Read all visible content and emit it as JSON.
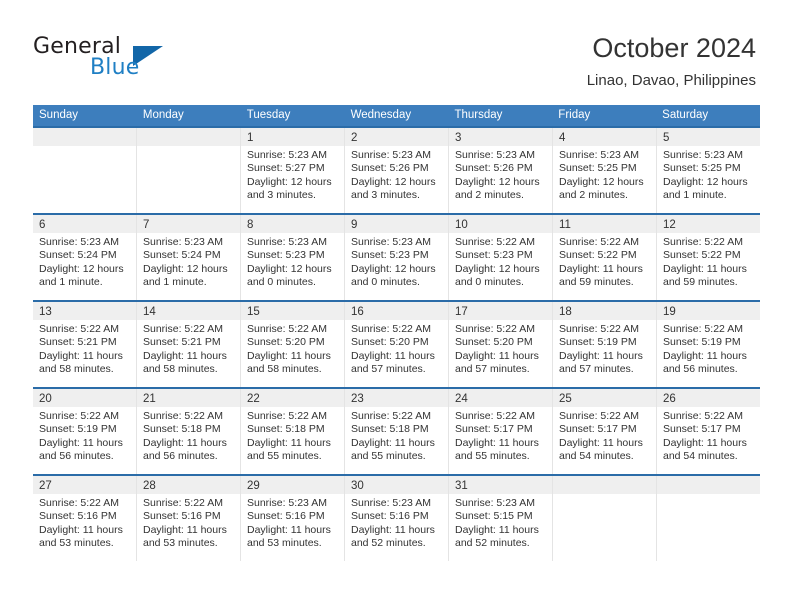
{
  "brand": {
    "name_part1": "General",
    "name_part2": "Blue",
    "triangle_icon": "triangle-icon",
    "accent_color": "#1f7fc4",
    "triangle_color": "#1266a8"
  },
  "header": {
    "title": "October 2024",
    "subtitle": "Linao, Davao, Philippines"
  },
  "colors": {
    "header_row_bg": "#3d7ebd",
    "week_divider": "#2b6ca8",
    "day_head_bg": "#efefef",
    "text": "#333333"
  },
  "weekdays": [
    "Sunday",
    "Monday",
    "Tuesday",
    "Wednesday",
    "Thursday",
    "Friday",
    "Saturday"
  ],
  "weeks": [
    [
      {
        "day": "",
        "sunrise": "",
        "sunset": "",
        "daylight_line1": "",
        "daylight_line2": "",
        "empty": true
      },
      {
        "day": "",
        "sunrise": "",
        "sunset": "",
        "daylight_line1": "",
        "daylight_line2": "",
        "empty": true
      },
      {
        "day": "1",
        "sunrise": "Sunrise: 5:23 AM",
        "sunset": "Sunset: 5:27 PM",
        "daylight_line1": "Daylight: 12 hours",
        "daylight_line2": "and 3 minutes."
      },
      {
        "day": "2",
        "sunrise": "Sunrise: 5:23 AM",
        "sunset": "Sunset: 5:26 PM",
        "daylight_line1": "Daylight: 12 hours",
        "daylight_line2": "and 3 minutes."
      },
      {
        "day": "3",
        "sunrise": "Sunrise: 5:23 AM",
        "sunset": "Sunset: 5:26 PM",
        "daylight_line1": "Daylight: 12 hours",
        "daylight_line2": "and 2 minutes."
      },
      {
        "day": "4",
        "sunrise": "Sunrise: 5:23 AM",
        "sunset": "Sunset: 5:25 PM",
        "daylight_line1": "Daylight: 12 hours",
        "daylight_line2": "and 2 minutes."
      },
      {
        "day": "5",
        "sunrise": "Sunrise: 5:23 AM",
        "sunset": "Sunset: 5:25 PM",
        "daylight_line1": "Daylight: 12 hours",
        "daylight_line2": "and 1 minute."
      }
    ],
    [
      {
        "day": "6",
        "sunrise": "Sunrise: 5:23 AM",
        "sunset": "Sunset: 5:24 PM",
        "daylight_line1": "Daylight: 12 hours",
        "daylight_line2": "and 1 minute."
      },
      {
        "day": "7",
        "sunrise": "Sunrise: 5:23 AM",
        "sunset": "Sunset: 5:24 PM",
        "daylight_line1": "Daylight: 12 hours",
        "daylight_line2": "and 1 minute."
      },
      {
        "day": "8",
        "sunrise": "Sunrise: 5:23 AM",
        "sunset": "Sunset: 5:23 PM",
        "daylight_line1": "Daylight: 12 hours",
        "daylight_line2": "and 0 minutes."
      },
      {
        "day": "9",
        "sunrise": "Sunrise: 5:23 AM",
        "sunset": "Sunset: 5:23 PM",
        "daylight_line1": "Daylight: 12 hours",
        "daylight_line2": "and 0 minutes."
      },
      {
        "day": "10",
        "sunrise": "Sunrise: 5:22 AM",
        "sunset": "Sunset: 5:23 PM",
        "daylight_line1": "Daylight: 12 hours",
        "daylight_line2": "and 0 minutes."
      },
      {
        "day": "11",
        "sunrise": "Sunrise: 5:22 AM",
        "sunset": "Sunset: 5:22 PM",
        "daylight_line1": "Daylight: 11 hours",
        "daylight_line2": "and 59 minutes."
      },
      {
        "day": "12",
        "sunrise": "Sunrise: 5:22 AM",
        "sunset": "Sunset: 5:22 PM",
        "daylight_line1": "Daylight: 11 hours",
        "daylight_line2": "and 59 minutes."
      }
    ],
    [
      {
        "day": "13",
        "sunrise": "Sunrise: 5:22 AM",
        "sunset": "Sunset: 5:21 PM",
        "daylight_line1": "Daylight: 11 hours",
        "daylight_line2": "and 58 minutes."
      },
      {
        "day": "14",
        "sunrise": "Sunrise: 5:22 AM",
        "sunset": "Sunset: 5:21 PM",
        "daylight_line1": "Daylight: 11 hours",
        "daylight_line2": "and 58 minutes."
      },
      {
        "day": "15",
        "sunrise": "Sunrise: 5:22 AM",
        "sunset": "Sunset: 5:20 PM",
        "daylight_line1": "Daylight: 11 hours",
        "daylight_line2": "and 58 minutes."
      },
      {
        "day": "16",
        "sunrise": "Sunrise: 5:22 AM",
        "sunset": "Sunset: 5:20 PM",
        "daylight_line1": "Daylight: 11 hours",
        "daylight_line2": "and 57 minutes."
      },
      {
        "day": "17",
        "sunrise": "Sunrise: 5:22 AM",
        "sunset": "Sunset: 5:20 PM",
        "daylight_line1": "Daylight: 11 hours",
        "daylight_line2": "and 57 minutes."
      },
      {
        "day": "18",
        "sunrise": "Sunrise: 5:22 AM",
        "sunset": "Sunset: 5:19 PM",
        "daylight_line1": "Daylight: 11 hours",
        "daylight_line2": "and 57 minutes."
      },
      {
        "day": "19",
        "sunrise": "Sunrise: 5:22 AM",
        "sunset": "Sunset: 5:19 PM",
        "daylight_line1": "Daylight: 11 hours",
        "daylight_line2": "and 56 minutes."
      }
    ],
    [
      {
        "day": "20",
        "sunrise": "Sunrise: 5:22 AM",
        "sunset": "Sunset: 5:19 PM",
        "daylight_line1": "Daylight: 11 hours",
        "daylight_line2": "and 56 minutes."
      },
      {
        "day": "21",
        "sunrise": "Sunrise: 5:22 AM",
        "sunset": "Sunset: 5:18 PM",
        "daylight_line1": "Daylight: 11 hours",
        "daylight_line2": "and 56 minutes."
      },
      {
        "day": "22",
        "sunrise": "Sunrise: 5:22 AM",
        "sunset": "Sunset: 5:18 PM",
        "daylight_line1": "Daylight: 11 hours",
        "daylight_line2": "and 55 minutes."
      },
      {
        "day": "23",
        "sunrise": "Sunrise: 5:22 AM",
        "sunset": "Sunset: 5:18 PM",
        "daylight_line1": "Daylight: 11 hours",
        "daylight_line2": "and 55 minutes."
      },
      {
        "day": "24",
        "sunrise": "Sunrise: 5:22 AM",
        "sunset": "Sunset: 5:17 PM",
        "daylight_line1": "Daylight: 11 hours",
        "daylight_line2": "and 55 minutes."
      },
      {
        "day": "25",
        "sunrise": "Sunrise: 5:22 AM",
        "sunset": "Sunset: 5:17 PM",
        "daylight_line1": "Daylight: 11 hours",
        "daylight_line2": "and 54 minutes."
      },
      {
        "day": "26",
        "sunrise": "Sunrise: 5:22 AM",
        "sunset": "Sunset: 5:17 PM",
        "daylight_line1": "Daylight: 11 hours",
        "daylight_line2": "and 54 minutes."
      }
    ],
    [
      {
        "day": "27",
        "sunrise": "Sunrise: 5:22 AM",
        "sunset": "Sunset: 5:16 PM",
        "daylight_line1": "Daylight: 11 hours",
        "daylight_line2": "and 53 minutes."
      },
      {
        "day": "28",
        "sunrise": "Sunrise: 5:22 AM",
        "sunset": "Sunset: 5:16 PM",
        "daylight_line1": "Daylight: 11 hours",
        "daylight_line2": "and 53 minutes."
      },
      {
        "day": "29",
        "sunrise": "Sunrise: 5:23 AM",
        "sunset": "Sunset: 5:16 PM",
        "daylight_line1": "Daylight: 11 hours",
        "daylight_line2": "and 53 minutes."
      },
      {
        "day": "30",
        "sunrise": "Sunrise: 5:23 AM",
        "sunset": "Sunset: 5:16 PM",
        "daylight_line1": "Daylight: 11 hours",
        "daylight_line2": "and 52 minutes."
      },
      {
        "day": "31",
        "sunrise": "Sunrise: 5:23 AM",
        "sunset": "Sunset: 5:15 PM",
        "daylight_line1": "Daylight: 11 hours",
        "daylight_line2": "and 52 minutes."
      },
      {
        "day": "",
        "sunrise": "",
        "sunset": "",
        "daylight_line1": "",
        "daylight_line2": "",
        "empty": true
      },
      {
        "day": "",
        "sunrise": "",
        "sunset": "",
        "daylight_line1": "",
        "daylight_line2": "",
        "empty": true
      }
    ]
  ]
}
